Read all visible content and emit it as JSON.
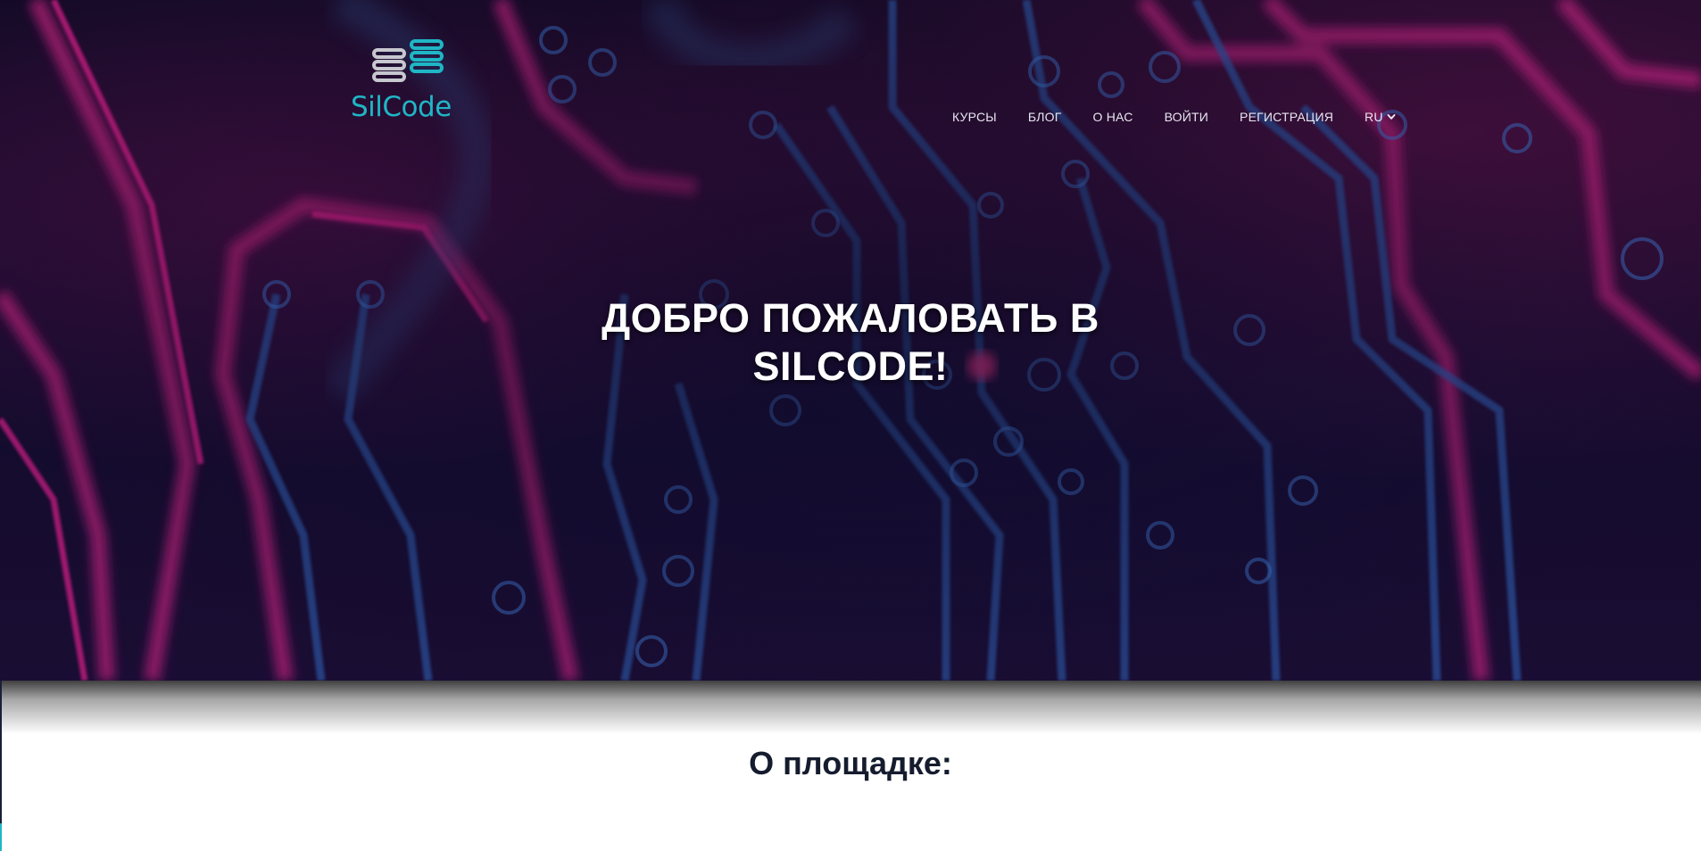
{
  "brand": {
    "name": "SilCode",
    "logo_icon": "stacked-lines-logo-icon",
    "accent_color": "#1fb6c6"
  },
  "nav": {
    "items": [
      {
        "label": "КУРСЫ"
      },
      {
        "label": "БЛОГ"
      },
      {
        "label": "О НАС"
      },
      {
        "label": "ВОЙТИ"
      },
      {
        "label": "РЕГИСТРАЦИЯ"
      }
    ],
    "language": {
      "selected": "RU",
      "icon": "chevron-down-icon"
    }
  },
  "hero": {
    "title_line1": "ДОБРО ПОЖАЛОВАТЬ В",
    "title_line2": "SILCODE!",
    "background": "circuit-board-image"
  },
  "section": {
    "title": "О площадке:"
  }
}
